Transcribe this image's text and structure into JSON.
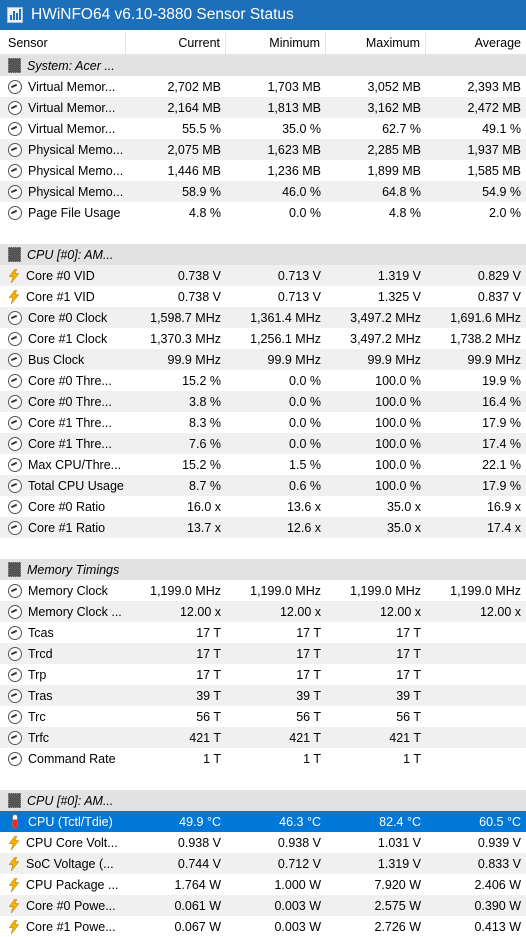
{
  "window": {
    "title": "HWiNFO64 v6.10-3880 Sensor Status"
  },
  "columns": [
    "Sensor",
    "Current",
    "Minimum",
    "Maximum",
    "Average"
  ],
  "rows": [
    {
      "t": "group",
      "icon": "chip-icon",
      "label": "System: Acer ..."
    },
    {
      "icon": "gauge-icon",
      "label": "Virtual Memor...",
      "cur": "2,702 MB",
      "min": "1,703 MB",
      "max": "3,052 MB",
      "avg": "2,393 MB"
    },
    {
      "icon": "gauge-icon",
      "label": "Virtual Memor...",
      "cur": "2,164 MB",
      "min": "1,813 MB",
      "max": "3,162 MB",
      "avg": "2,472 MB"
    },
    {
      "icon": "gauge-icon",
      "label": "Virtual Memor...",
      "cur": "55.5 %",
      "min": "35.0 %",
      "max": "62.7 %",
      "avg": "49.1 %"
    },
    {
      "icon": "gauge-icon",
      "label": "Physical Memo...",
      "cur": "2,075 MB",
      "min": "1,623 MB",
      "max": "2,285 MB",
      "avg": "1,937 MB"
    },
    {
      "icon": "gauge-icon",
      "label": "Physical Memo...",
      "cur": "1,446 MB",
      "min": "1,236 MB",
      "max": "1,899 MB",
      "avg": "1,585 MB"
    },
    {
      "icon": "gauge-icon",
      "label": "Physical Memo...",
      "cur": "58.9 %",
      "min": "46.0 %",
      "max": "64.8 %",
      "avg": "54.9 %"
    },
    {
      "icon": "gauge-icon",
      "label": "Page File Usage",
      "cur": "4.8 %",
      "min": "0.0 %",
      "max": "4.8 %",
      "avg": "2.0 %"
    },
    {
      "t": "blank"
    },
    {
      "t": "group",
      "icon": "chip-icon",
      "label": "CPU [#0]: AM..."
    },
    {
      "icon": "bolt-icon",
      "label": "Core #0 VID",
      "cur": "0.738 V",
      "min": "0.713 V",
      "max": "1.319 V",
      "avg": "0.829 V"
    },
    {
      "icon": "bolt-icon",
      "label": "Core #1 VID",
      "cur": "0.738 V",
      "min": "0.713 V",
      "max": "1.325 V",
      "avg": "0.837 V"
    },
    {
      "icon": "gauge-icon",
      "label": "Core #0 Clock",
      "cur": "1,598.7 MHz",
      "min": "1,361.4 MHz",
      "max": "3,497.2 MHz",
      "avg": "1,691.6 MHz"
    },
    {
      "icon": "gauge-icon",
      "label": "Core #1 Clock",
      "cur": "1,370.3 MHz",
      "min": "1,256.1 MHz",
      "max": "3,497.2 MHz",
      "avg": "1,738.2 MHz"
    },
    {
      "icon": "gauge-icon",
      "label": "Bus Clock",
      "cur": "99.9 MHz",
      "min": "99.9 MHz",
      "max": "99.9 MHz",
      "avg": "99.9 MHz"
    },
    {
      "icon": "gauge-icon",
      "label": "Core #0 Thre...",
      "cur": "15.2 %",
      "min": "0.0 %",
      "max": "100.0 %",
      "avg": "19.9 %"
    },
    {
      "icon": "gauge-icon",
      "label": "Core #0 Thre...",
      "cur": "3.8 %",
      "min": "0.0 %",
      "max": "100.0 %",
      "avg": "16.4 %"
    },
    {
      "icon": "gauge-icon",
      "label": "Core #1 Thre...",
      "cur": "8.3 %",
      "min": "0.0 %",
      "max": "100.0 %",
      "avg": "17.9 %"
    },
    {
      "icon": "gauge-icon",
      "label": "Core #1 Thre...",
      "cur": "7.6 %",
      "min": "0.0 %",
      "max": "100.0 %",
      "avg": "17.4 %"
    },
    {
      "icon": "gauge-icon",
      "label": "Max CPU/Thre...",
      "cur": "15.2 %",
      "min": "1.5 %",
      "max": "100.0 %",
      "avg": "22.1 %"
    },
    {
      "icon": "gauge-icon",
      "label": "Total CPU Usage",
      "cur": "8.7 %",
      "min": "0.6 %",
      "max": "100.0 %",
      "avg": "17.9 %"
    },
    {
      "icon": "gauge-icon",
      "label": "Core #0 Ratio",
      "cur": "16.0 x",
      "min": "13.6 x",
      "max": "35.0 x",
      "avg": "16.9 x"
    },
    {
      "icon": "gauge-icon",
      "label": "Core #1 Ratio",
      "cur": "13.7 x",
      "min": "12.6 x",
      "max": "35.0 x",
      "avg": "17.4 x"
    },
    {
      "t": "blank"
    },
    {
      "t": "group",
      "icon": "chip-icon",
      "label": "Memory Timings"
    },
    {
      "icon": "gauge-icon",
      "label": "Memory Clock",
      "cur": "1,199.0 MHz",
      "min": "1,199.0 MHz",
      "max": "1,199.0 MHz",
      "avg": "1,199.0 MHz"
    },
    {
      "icon": "gauge-icon",
      "label": "Memory Clock ...",
      "cur": "12.00 x",
      "min": "12.00 x",
      "max": "12.00 x",
      "avg": "12.00 x"
    },
    {
      "icon": "gauge-icon",
      "label": "Tcas",
      "cur": "17 T",
      "min": "17 T",
      "max": "17 T",
      "avg": ""
    },
    {
      "icon": "gauge-icon",
      "label": "Trcd",
      "cur": "17 T",
      "min": "17 T",
      "max": "17 T",
      "avg": ""
    },
    {
      "icon": "gauge-icon",
      "label": "Trp",
      "cur": "17 T",
      "min": "17 T",
      "max": "17 T",
      "avg": ""
    },
    {
      "icon": "gauge-icon",
      "label": "Tras",
      "cur": "39 T",
      "min": "39 T",
      "max": "39 T",
      "avg": ""
    },
    {
      "icon": "gauge-icon",
      "label": "Trc",
      "cur": "56 T",
      "min": "56 T",
      "max": "56 T",
      "avg": ""
    },
    {
      "icon": "gauge-icon",
      "label": "Trfc",
      "cur": "421 T",
      "min": "421 T",
      "max": "421 T",
      "avg": ""
    },
    {
      "icon": "gauge-icon",
      "label": "Command Rate",
      "cur": "1 T",
      "min": "1 T",
      "max": "1 T",
      "avg": ""
    },
    {
      "t": "blank"
    },
    {
      "t": "group",
      "icon": "chip-icon",
      "label": "CPU [#0]: AM..."
    },
    {
      "t": "sel",
      "icon": "thermometer-icon",
      "label": "CPU (Tctl/Tdie)",
      "cur": "49.9 °C",
      "min": "46.3 °C",
      "max": "82.4 °C",
      "avg": "60.5 °C"
    },
    {
      "icon": "bolt-icon",
      "label": "CPU Core Volt...",
      "cur": "0.938 V",
      "min": "0.938 V",
      "max": "1.031 V",
      "avg": "0.939 V"
    },
    {
      "icon": "bolt-icon",
      "label": "SoC Voltage (...",
      "cur": "0.744 V",
      "min": "0.712 V",
      "max": "1.319 V",
      "avg": "0.833 V"
    },
    {
      "icon": "bolt-icon",
      "label": "CPU Package ...",
      "cur": "1.764 W",
      "min": "1.000 W",
      "max": "7.920 W",
      "avg": "2.406 W"
    },
    {
      "icon": "bolt-icon",
      "label": "Core #0 Powe...",
      "cur": "0.061 W",
      "min": "0.003 W",
      "max": "2.575 W",
      "avg": "0.390 W"
    },
    {
      "icon": "bolt-icon",
      "label": "Core #1 Powe...",
      "cur": "0.067 W",
      "min": "0.003 W",
      "max": "2.726 W",
      "avg": "0.413 W"
    }
  ]
}
